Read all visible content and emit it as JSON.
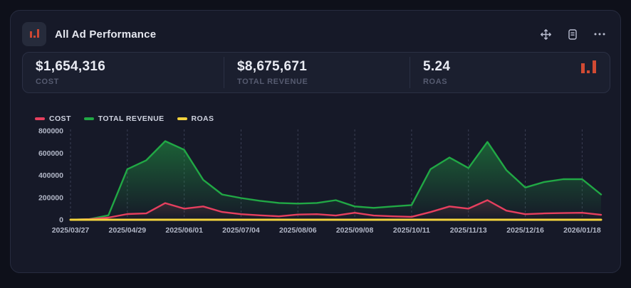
{
  "card": {
    "title": "All Ad Performance",
    "header_icon": "bar-chart-logo",
    "toolbar_icons": [
      "move-handle",
      "notepad",
      "ellipsis-menu"
    ]
  },
  "metrics": [
    {
      "value": "$1,654,316",
      "label": "COST"
    },
    {
      "value": "$8,675,671",
      "label": "TOTAL REVENUE"
    },
    {
      "value": "5.24",
      "label": "ROAS"
    }
  ],
  "metrics_icon": "bar-chart-logo",
  "colors": {
    "page_bg": "#0e101a",
    "card_bg": "#161928",
    "card_border": "#272c3f",
    "panel_bg": "#1b1f2f",
    "accent_red": "#cc4733",
    "cost_line": "#e63f5e",
    "revenue_line": "#21a845",
    "roas_line": "#f3d23d",
    "gridline": "#3a3f54",
    "axis_text": "#b2b7c7"
  },
  "chart_data": {
    "type": "line",
    "title": "All Ad Performance",
    "x": [
      "2025/03/27",
      "2025/04/07",
      "2025/04/18",
      "2025/04/29",
      "2025/05/10",
      "2025/05/21",
      "2025/06/01",
      "2025/06/12",
      "2025/06/23",
      "2025/07/04",
      "2025/07/15",
      "2025/07/26",
      "2025/08/06",
      "2025/08/17",
      "2025/08/28",
      "2025/09/08",
      "2025/09/19",
      "2025/09/30",
      "2025/10/11",
      "2025/10/22",
      "2025/11/02",
      "2025/11/13",
      "2025/11/24",
      "2025/12/05",
      "2025/12/16",
      "2025/12/27",
      "2026/01/07",
      "2026/01/18",
      "2026/01/29"
    ],
    "x_label_every": 3,
    "x_tick_labels": [
      "2025/03/27",
      "2025/04/29",
      "2025/06/01",
      "2025/07/04",
      "2025/08/06",
      "2025/09/08",
      "2025/10/11",
      "2025/11/13",
      "2025/12/16",
      "2026/01/18"
    ],
    "series": [
      {
        "name": "COST",
        "color": "#e63f5e",
        "fill_alpha": 0.18,
        "values": [
          0,
          5000,
          19000,
          51000,
          57000,
          150000,
          100000,
          120000,
          70000,
          50000,
          40000,
          31000,
          47000,
          50000,
          38000,
          63000,
          38000,
          31000,
          26000,
          69000,
          120000,
          100000,
          176000,
          82000,
          50000,
          57000,
          60000,
          63000,
          44000
        ]
      },
      {
        "name": "TOTAL REVENUE",
        "color": "#21a845",
        "fill_alpha": 0.5,
        "values": [
          0,
          6000,
          40000,
          455000,
          535000,
          707000,
          630000,
          359000,
          227000,
          195000,
          170000,
          151000,
          145000,
          151000,
          176000,
          120000,
          107000,
          120000,
          132000,
          455000,
          560000,
          465000,
          700000,
          447000,
          290000,
          340000,
          365000,
          365000,
          227000
        ]
      },
      {
        "name": "ROAS",
        "color": "#f3d23d",
        "fill_alpha": 0,
        "values": [
          0,
          1.2,
          2.11,
          8.92,
          9.39,
          4.71,
          6.3,
          2.99,
          3.24,
          3.9,
          4.25,
          4.87,
          3.09,
          3.02,
          4.63,
          1.9,
          2.82,
          3.87,
          5.08,
          6.59,
          4.67,
          4.65,
          3.98,
          5.45,
          5.8,
          5.96,
          6.08,
          5.79,
          5.16
        ]
      }
    ],
    "legend": [
      "COST",
      "TOTAL REVENUE",
      "ROAS"
    ],
    "legend_position": "top-left",
    "ylim": [
      0,
      800000
    ],
    "yticks": [
      0,
      200000,
      400000,
      600000,
      800000
    ],
    "grid": "vertical-dashed",
    "xlabel": "",
    "ylabel": ""
  }
}
